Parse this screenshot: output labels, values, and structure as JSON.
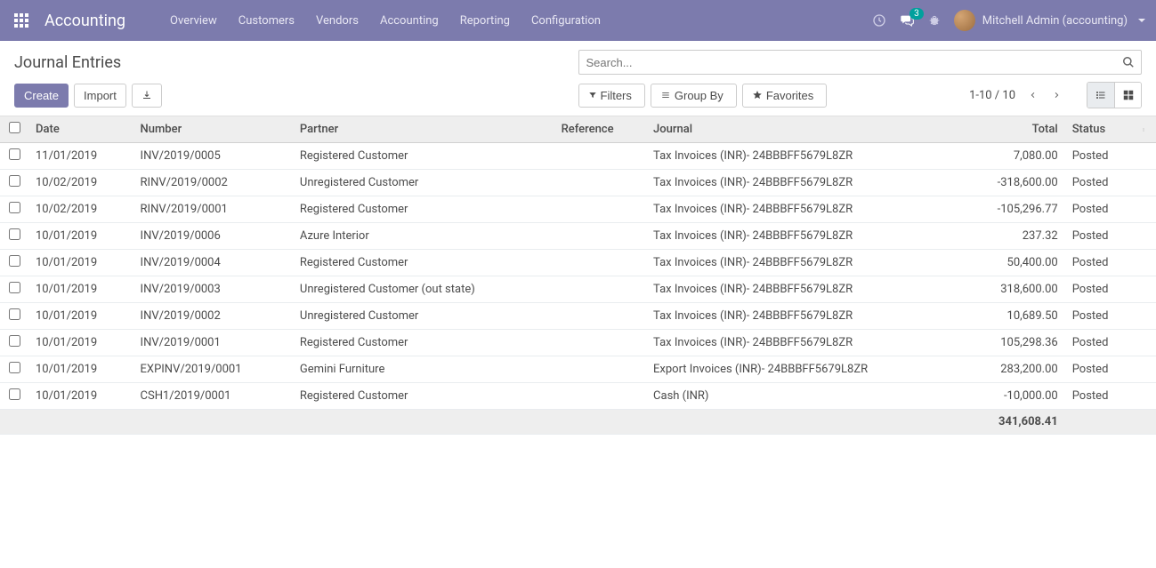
{
  "navbar": {
    "app_title": "Accounting",
    "menu": [
      "Overview",
      "Customers",
      "Vendors",
      "Accounting",
      "Reporting",
      "Configuration"
    ],
    "message_count": "3",
    "user_name": "Mitchell Admin (accounting)"
  },
  "control_panel": {
    "title": "Journal Entries",
    "create_label": "Create",
    "import_label": "Import",
    "search_placeholder": "Search...",
    "filters_label": "Filters",
    "groupby_label": "Group By",
    "favorites_label": "Favorites",
    "pager_text": "1-10 / 10"
  },
  "columns": [
    "Date",
    "Number",
    "Partner",
    "Reference",
    "Journal",
    "Total",
    "Status"
  ],
  "rows": [
    {
      "date": "11/01/2019",
      "number": "INV/2019/0005",
      "partner": "Registered Customer",
      "reference": "",
      "journal": "Tax Invoices (INR)- 24BBBFF5679L8ZR",
      "total": "7,080.00",
      "status": "Posted"
    },
    {
      "date": "10/02/2019",
      "number": "RINV/2019/0002",
      "partner": "Unregistered Customer",
      "reference": "",
      "journal": "Tax Invoices (INR)- 24BBBFF5679L8ZR",
      "total": "-318,600.00",
      "status": "Posted"
    },
    {
      "date": "10/02/2019",
      "number": "RINV/2019/0001",
      "partner": "Registered Customer",
      "reference": "",
      "journal": "Tax Invoices (INR)- 24BBBFF5679L8ZR",
      "total": "-105,296.77",
      "status": "Posted"
    },
    {
      "date": "10/01/2019",
      "number": "INV/2019/0006",
      "partner": "Azure Interior",
      "reference": "",
      "journal": "Tax Invoices (INR)- 24BBBFF5679L8ZR",
      "total": "237.32",
      "status": "Posted"
    },
    {
      "date": "10/01/2019",
      "number": "INV/2019/0004",
      "partner": "Registered Customer",
      "reference": "",
      "journal": "Tax Invoices (INR)- 24BBBFF5679L8ZR",
      "total": "50,400.00",
      "status": "Posted"
    },
    {
      "date": "10/01/2019",
      "number": "INV/2019/0003",
      "partner": "Unregistered Customer (out state)",
      "reference": "",
      "journal": "Tax Invoices (INR)- 24BBBFF5679L8ZR",
      "total": "318,600.00",
      "status": "Posted"
    },
    {
      "date": "10/01/2019",
      "number": "INV/2019/0002",
      "partner": "Unregistered Customer",
      "reference": "",
      "journal": "Tax Invoices (INR)- 24BBBFF5679L8ZR",
      "total": "10,689.50",
      "status": "Posted"
    },
    {
      "date": "10/01/2019",
      "number": "INV/2019/0001",
      "partner": "Registered Customer",
      "reference": "",
      "journal": "Tax Invoices (INR)- 24BBBFF5679L8ZR",
      "total": "105,298.36",
      "status": "Posted"
    },
    {
      "date": "10/01/2019",
      "number": "EXPINV/2019/0001",
      "partner": "Gemini Furniture",
      "reference": "",
      "journal": "Export Invoices (INR)- 24BBBFF5679L8ZR",
      "total": "283,200.00",
      "status": "Posted"
    },
    {
      "date": "10/01/2019",
      "number": "CSH1/2019/0001",
      "partner": "Registered Customer",
      "reference": "",
      "journal": "Cash (INR)",
      "total": "-10,000.00",
      "status": "Posted"
    }
  ],
  "footer_total": "341,608.41"
}
